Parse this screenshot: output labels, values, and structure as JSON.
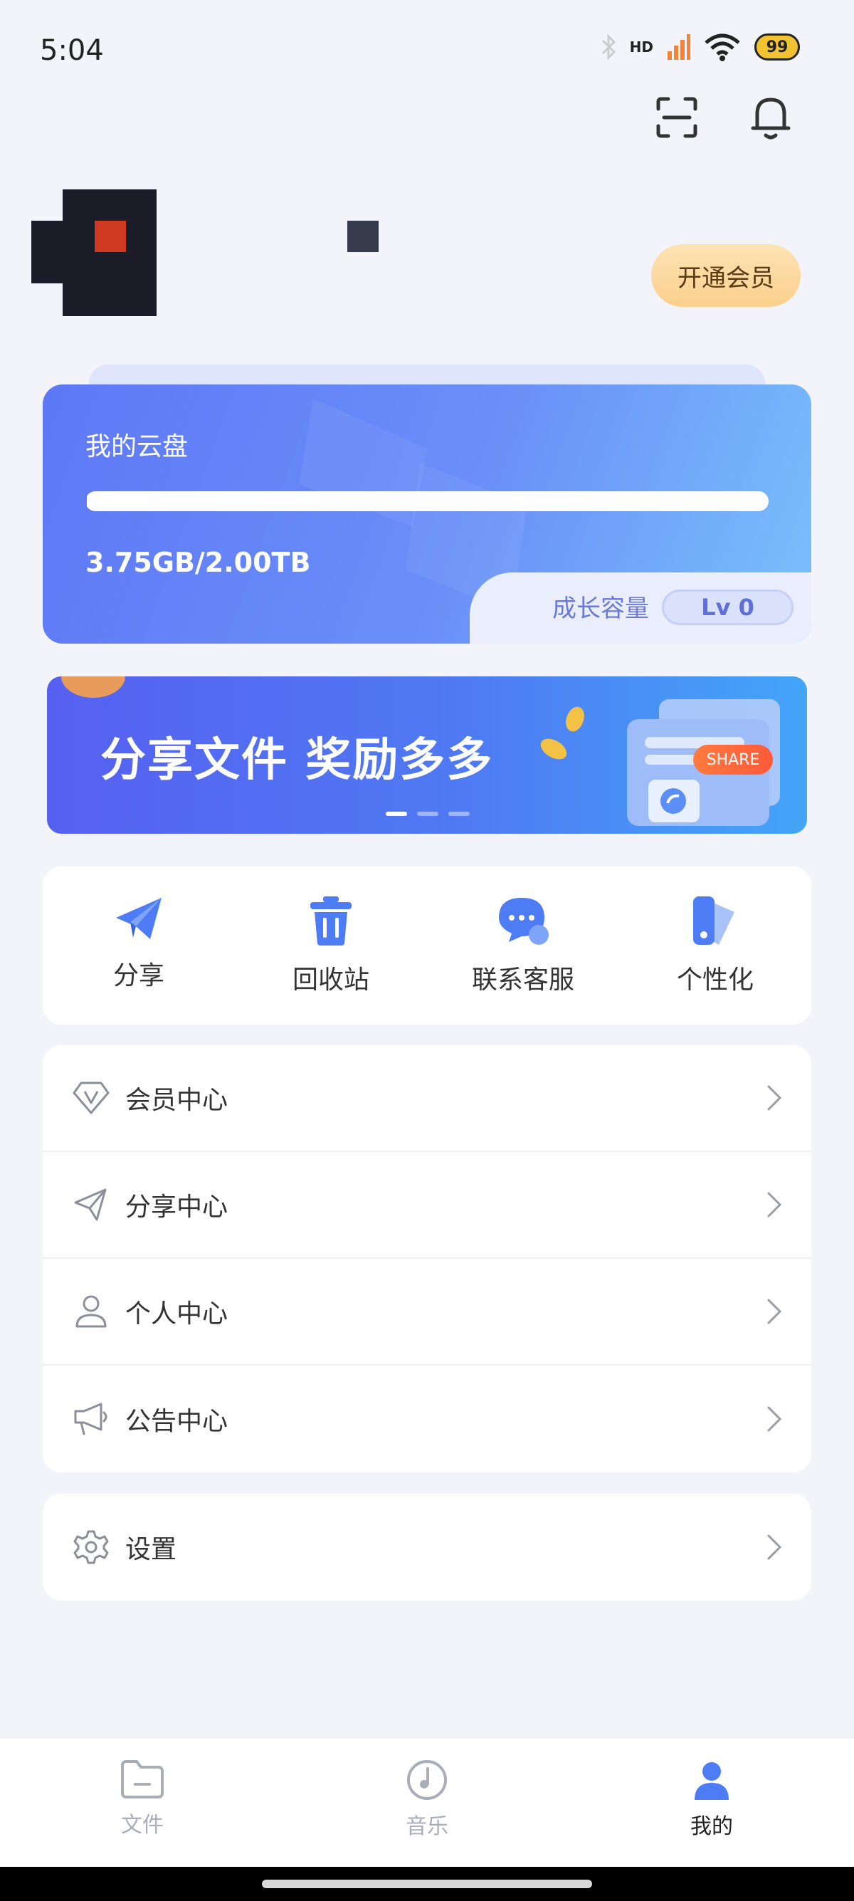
{
  "status_bar": {
    "time": "5:04",
    "battery": "99",
    "network": "HD"
  },
  "profile": {
    "vip_button": "开通会员"
  },
  "cloud": {
    "title": "我的云盘",
    "usage": "3.75GB/2.00TB",
    "growth_label": "成长容量",
    "level": "Lv 0",
    "progress_fraction": 0.0018
  },
  "banner": {
    "text": "分享文件  奖励多多",
    "tag": "SHARE",
    "slide_count": 3,
    "active_slide": 0
  },
  "quick_actions": [
    {
      "label": "分享",
      "icon": "paper-plane-icon"
    },
    {
      "label": "回收站",
      "icon": "trash-icon"
    },
    {
      "label": "联系客服",
      "icon": "chat-bubble-icon"
    },
    {
      "label": "个性化",
      "icon": "theme-swatch-icon"
    }
  ],
  "menu": [
    {
      "label": "会员中心",
      "icon": "diamond-icon"
    },
    {
      "label": "分享中心",
      "icon": "send-icon"
    },
    {
      "label": "个人中心",
      "icon": "user-icon"
    },
    {
      "label": "公告中心",
      "icon": "megaphone-icon"
    }
  ],
  "settings": {
    "label": "设置",
    "icon": "gear-icon"
  },
  "bottom_nav": [
    {
      "label": "文件",
      "icon": "folder-icon",
      "active": false
    },
    {
      "label": "音乐",
      "icon": "music-disc-icon",
      "active": false
    },
    {
      "label": "我的",
      "icon": "person-icon",
      "active": true
    }
  ],
  "colors": {
    "accent": "#5e78f6",
    "background": "#f3f4f9",
    "vip_gold": "#fbd08d"
  }
}
